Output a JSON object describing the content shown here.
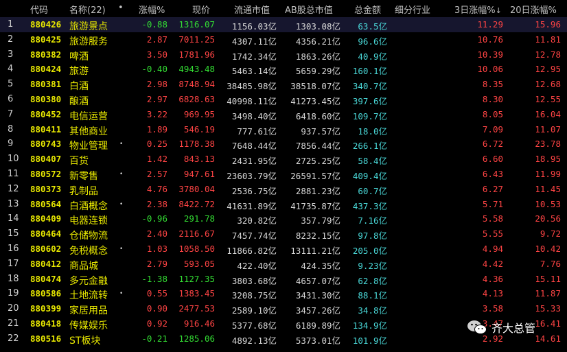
{
  "header": {
    "code": "代码",
    "name": "名称(22)",
    "dot": "•",
    "change_pct": "涨幅%",
    "price": "现价",
    "float_cap": "流通市值",
    "ab_cap": "AB股总市值",
    "amount": "总金额",
    "sub_industry": "细分行业",
    "day3": "3日涨幅%",
    "day3_arrow": "↓",
    "day20": "20日涨幅%"
  },
  "rows": [
    {
      "idx": "1",
      "code": "880426",
      "name": "旅游景点",
      "mark": "",
      "chg": "-0.88",
      "price": "1316.07",
      "float": "1156.03亿",
      "ab": "1303.08亿",
      "amt": "63.5亿",
      "d3": "11.29",
      "d20": "15.96",
      "dir": "down"
    },
    {
      "idx": "2",
      "code": "880425",
      "name": "旅游服务",
      "mark": "",
      "chg": "2.87",
      "price": "7011.25",
      "float": "4307.11亿",
      "ab": "4356.21亿",
      "amt": "96.6亿",
      "d3": "10.76",
      "d20": "11.81",
      "dir": "up"
    },
    {
      "idx": "3",
      "code": "880382",
      "name": "啤酒",
      "mark": "",
      "chg": "3.50",
      "price": "1781.96",
      "float": "1742.34亿",
      "ab": "1863.26亿",
      "amt": "40.9亿",
      "d3": "10.39",
      "d20": "12.78",
      "dir": "up"
    },
    {
      "idx": "4",
      "code": "880424",
      "name": "旅游",
      "mark": "",
      "chg": "-0.40",
      "price": "4943.48",
      "float": "5463.14亿",
      "ab": "5659.29亿",
      "amt": "160.1亿",
      "d3": "10.06",
      "d20": "12.95",
      "dir": "down"
    },
    {
      "idx": "5",
      "code": "880381",
      "name": "白酒",
      "mark": "",
      "chg": "2.98",
      "price": "8748.94",
      "float": "38485.98亿",
      "ab": "38518.07亿",
      "amt": "340.7亿",
      "d3": "8.35",
      "d20": "12.68",
      "dir": "up"
    },
    {
      "idx": "6",
      "code": "880380",
      "name": "酿酒",
      "mark": "",
      "chg": "2.97",
      "price": "6828.63",
      "float": "40998.11亿",
      "ab": "41273.45亿",
      "amt": "397.6亿",
      "d3": "8.30",
      "d20": "12.55",
      "dir": "up"
    },
    {
      "idx": "7",
      "code": "880452",
      "name": "电信运营",
      "mark": "",
      "chg": "3.22",
      "price": "969.95",
      "float": "3498.40亿",
      "ab": "6418.60亿",
      "amt": "109.7亿",
      "d3": "8.05",
      "d20": "16.04",
      "dir": "up"
    },
    {
      "idx": "8",
      "code": "880411",
      "name": "其他商业",
      "mark": "",
      "chg": "1.89",
      "price": "546.19",
      "float": "777.61亿",
      "ab": "937.57亿",
      "amt": "18.0亿",
      "d3": "7.09",
      "d20": "11.07",
      "dir": "up"
    },
    {
      "idx": "9",
      "code": "880743",
      "name": "物业管理",
      "mark": "•",
      "chg": "0.25",
      "price": "1178.38",
      "float": "7648.44亿",
      "ab": "7856.44亿",
      "amt": "266.1亿",
      "d3": "6.72",
      "d20": "23.78",
      "dir": "up"
    },
    {
      "idx": "10",
      "code": "880407",
      "name": "百货",
      "mark": "",
      "chg": "1.42",
      "price": "843.13",
      "float": "2431.95亿",
      "ab": "2725.25亿",
      "amt": "58.4亿",
      "d3": "6.60",
      "d20": "18.95",
      "dir": "up"
    },
    {
      "idx": "11",
      "code": "880572",
      "name": "新零售",
      "mark": "•",
      "chg": "2.57",
      "price": "947.61",
      "float": "23603.79亿",
      "ab": "26591.57亿",
      "amt": "409.4亿",
      "d3": "6.43",
      "d20": "11.99",
      "dir": "up"
    },
    {
      "idx": "12",
      "code": "880373",
      "name": "乳制品",
      "mark": "",
      "chg": "4.76",
      "price": "3780.04",
      "float": "2536.75亿",
      "ab": "2881.23亿",
      "amt": "60.7亿",
      "d3": "6.27",
      "d20": "11.45",
      "dir": "up"
    },
    {
      "idx": "13",
      "code": "880564",
      "name": "白酒概念",
      "mark": "•",
      "chg": "2.38",
      "price": "8422.72",
      "float": "41631.89亿",
      "ab": "41735.87亿",
      "amt": "437.3亿",
      "d3": "5.71",
      "d20": "10.53",
      "dir": "up"
    },
    {
      "idx": "14",
      "code": "880409",
      "name": "电器连锁",
      "mark": "",
      "chg": "-0.96",
      "price": "291.78",
      "float": "320.82亿",
      "ab": "357.79亿",
      "amt": "7.16亿",
      "d3": "5.58",
      "d20": "20.56",
      "dir": "down"
    },
    {
      "idx": "15",
      "code": "880464",
      "name": "仓储物流",
      "mark": "",
      "chg": "2.40",
      "price": "2116.67",
      "float": "7457.74亿",
      "ab": "8232.15亿",
      "amt": "97.8亿",
      "d3": "5.55",
      "d20": "9.72",
      "dir": "up"
    },
    {
      "idx": "16",
      "code": "880602",
      "name": "免税概念",
      "mark": "•",
      "chg": "1.03",
      "price": "1058.50",
      "float": "11866.82亿",
      "ab": "13111.21亿",
      "amt": "205.0亿",
      "d3": "4.94",
      "d20": "10.42",
      "dir": "up"
    },
    {
      "idx": "17",
      "code": "880412",
      "name": "商品城",
      "mark": "",
      "chg": "2.79",
      "price": "593.05",
      "float": "422.40亿",
      "ab": "424.35亿",
      "amt": "9.23亿",
      "d3": "4.42",
      "d20": "7.76",
      "dir": "up"
    },
    {
      "idx": "18",
      "code": "880474",
      "name": "多元金融",
      "mark": "",
      "chg": "-1.38",
      "price": "1127.35",
      "float": "3803.68亿",
      "ab": "4657.07亿",
      "amt": "62.8亿",
      "d3": "4.36",
      "d20": "15.11",
      "dir": "down"
    },
    {
      "idx": "19",
      "code": "880586",
      "name": "土地流转",
      "mark": "•",
      "chg": "0.55",
      "price": "1383.45",
      "float": "3208.75亿",
      "ab": "3431.30亿",
      "amt": "88.1亿",
      "d3": "4.13",
      "d20": "11.87",
      "dir": "up"
    },
    {
      "idx": "20",
      "code": "880399",
      "name": "家居用品",
      "mark": "",
      "chg": "0.90",
      "price": "2477.53",
      "float": "2589.10亿",
      "ab": "3457.26亿",
      "amt": "34.8亿",
      "d3": "3.58",
      "d20": "15.33",
      "dir": "up"
    },
    {
      "idx": "21",
      "code": "880418",
      "name": "传媒娱乐",
      "mark": "",
      "chg": "0.92",
      "price": "916.46",
      "float": "5377.68亿",
      "ab": "6189.89亿",
      "amt": "134.9亿",
      "d3": "3.47",
      "d20": "16.41",
      "dir": "up"
    },
    {
      "idx": "22",
      "code": "880516",
      "name": "ST板块",
      "mark": "",
      "chg": "-0.21",
      "price": "1285.06",
      "float": "4892.13亿",
      "ab": "5373.01亿",
      "amt": "101.9亿",
      "d3": "2.92",
      "d20": "14.61",
      "dir": "down"
    }
  ],
  "watermark": {
    "text": "齐大总管",
    "icon": "wechat-icon"
  },
  "colors": {
    "up": "#ff4444",
    "down": "#33dd33",
    "code": "#e8e800",
    "amount": "#4ad8d8",
    "background": "#000000"
  }
}
